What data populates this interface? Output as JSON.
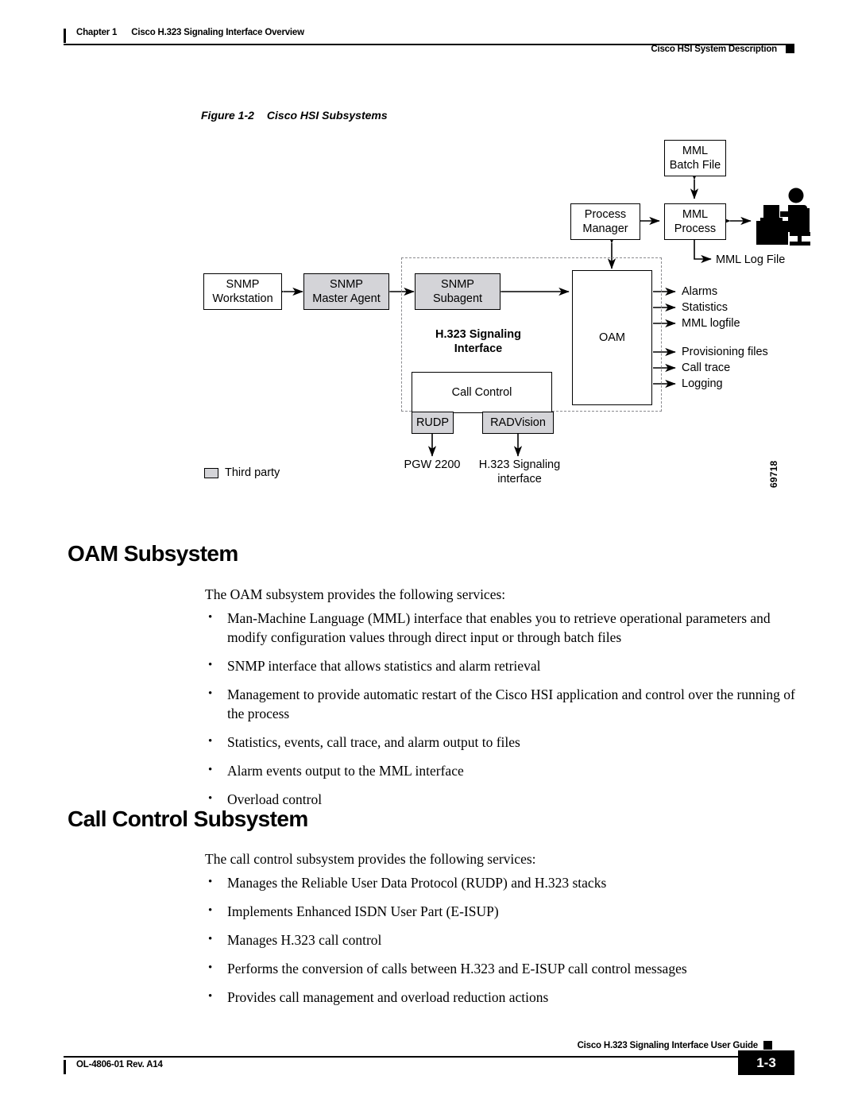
{
  "header": {
    "chapter_label": "Chapter 1",
    "chapter_title": "Cisco H.323 Signaling Interface Overview",
    "section_title": "Cisco HSI System Description"
  },
  "figure": {
    "number": "Figure 1-2",
    "title": "Cisco HSI Subsystems",
    "figure_id": "69718",
    "boxes": {
      "mml_batch_file": "MML\nBatch File",
      "mml_batch_file_l1": "MML",
      "mml_batch_file_l2": "Batch File",
      "process_manager_l1": "Process",
      "process_manager_l2": "Manager",
      "mml_process_l1": "MML",
      "mml_process_l2": "Process",
      "snmp_workstation_l1": "SNMP",
      "snmp_workstation_l2": "Workstation",
      "snmp_master_agent_l1": "SNMP",
      "snmp_master_agent_l2": "Master Agent",
      "snmp_subagent_l1": "SNMP",
      "snmp_subagent_l2": "Subagent",
      "oam": "OAM",
      "call_control": "Call Control",
      "rudp": "RUDP",
      "radvision": "RADVision"
    },
    "region_label_l1": "H.323 Signaling",
    "region_label_l2": "Interface",
    "mml_log_file": "MML Log File",
    "outputs_group_a": [
      "Alarms",
      "Statistics",
      "MML logfile"
    ],
    "outputs_group_b": [
      "Provisioning files",
      "Call trace",
      "Logging"
    ],
    "bottom_labels": {
      "pgw": "PGW 2200",
      "h323_l1": "H.323 Signaling",
      "h323_l2": "interface"
    },
    "legend": {
      "third_party": "Third party"
    }
  },
  "sections": [
    {
      "heading": "OAM Subsystem",
      "intro": "The OAM subsystem provides the following services:",
      "bullets": [
        "Man-Machine Language (MML) interface that enables you to retrieve operational parameters and modify configuration values through direct input or through batch files",
        "SNMP interface that allows statistics and alarm retrieval",
        "Management to provide automatic restart of the Cisco HSI application and control over the running of the process",
        "Statistics, events, call trace, and alarm output to files",
        "Alarm events output to the MML interface",
        "Overload control"
      ]
    },
    {
      "heading": "Call Control Subsystem",
      "intro": "The call control subsystem provides the following services:",
      "bullets": [
        "Manages the Reliable User Data Protocol (RUDP) and H.323 stacks",
        "Implements Enhanced ISDN User Part (E-ISUP)",
        "Manages H.323 call control",
        "Performs the conversion of calls between H.323 and E-ISUP call control messages",
        "Provides call management and overload reduction actions"
      ]
    }
  ],
  "footer": {
    "doc_id": "OL-4806-01 Rev. A14",
    "guide_title": "Cisco H.323 Signaling Interface User Guide",
    "page_number": "1-3"
  }
}
